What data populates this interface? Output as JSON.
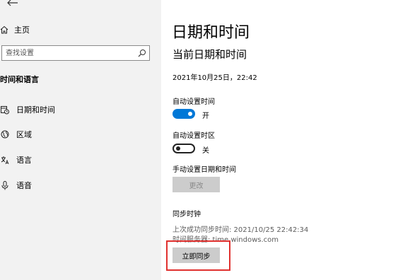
{
  "sidebar": {
    "home_label": "主页",
    "search_placeholder": "查找设置",
    "section_title": "时间和语言",
    "items": [
      {
        "label": "日期和时间",
        "icon": "calendar-clock-icon"
      },
      {
        "label": "区域",
        "icon": "globe-icon"
      },
      {
        "label": "语言",
        "icon": "language-icon"
      },
      {
        "label": "语音",
        "icon": "microphone-icon"
      }
    ]
  },
  "main": {
    "page_title": "日期和时间",
    "section_title": "当前日期和时间",
    "current_datetime": "2021年10月25日，22:42",
    "auto_time": {
      "label": "自动设置时间",
      "state": "开",
      "on": true
    },
    "auto_timezone": {
      "label": "自动设置时区",
      "state": "关",
      "on": false
    },
    "manual": {
      "label": "手动设置日期和时间",
      "button": "更改"
    },
    "sync": {
      "label": "同步时钟",
      "last_sync": "上次成功同步时间: 2021/10/25 22:42:34",
      "server": "时间服务器: time.windows.com",
      "button": "立即同步"
    }
  },
  "colors": {
    "accent": "#0078d7",
    "highlight": "#e0312f",
    "sidebar_bg": "#f2f2f2"
  }
}
